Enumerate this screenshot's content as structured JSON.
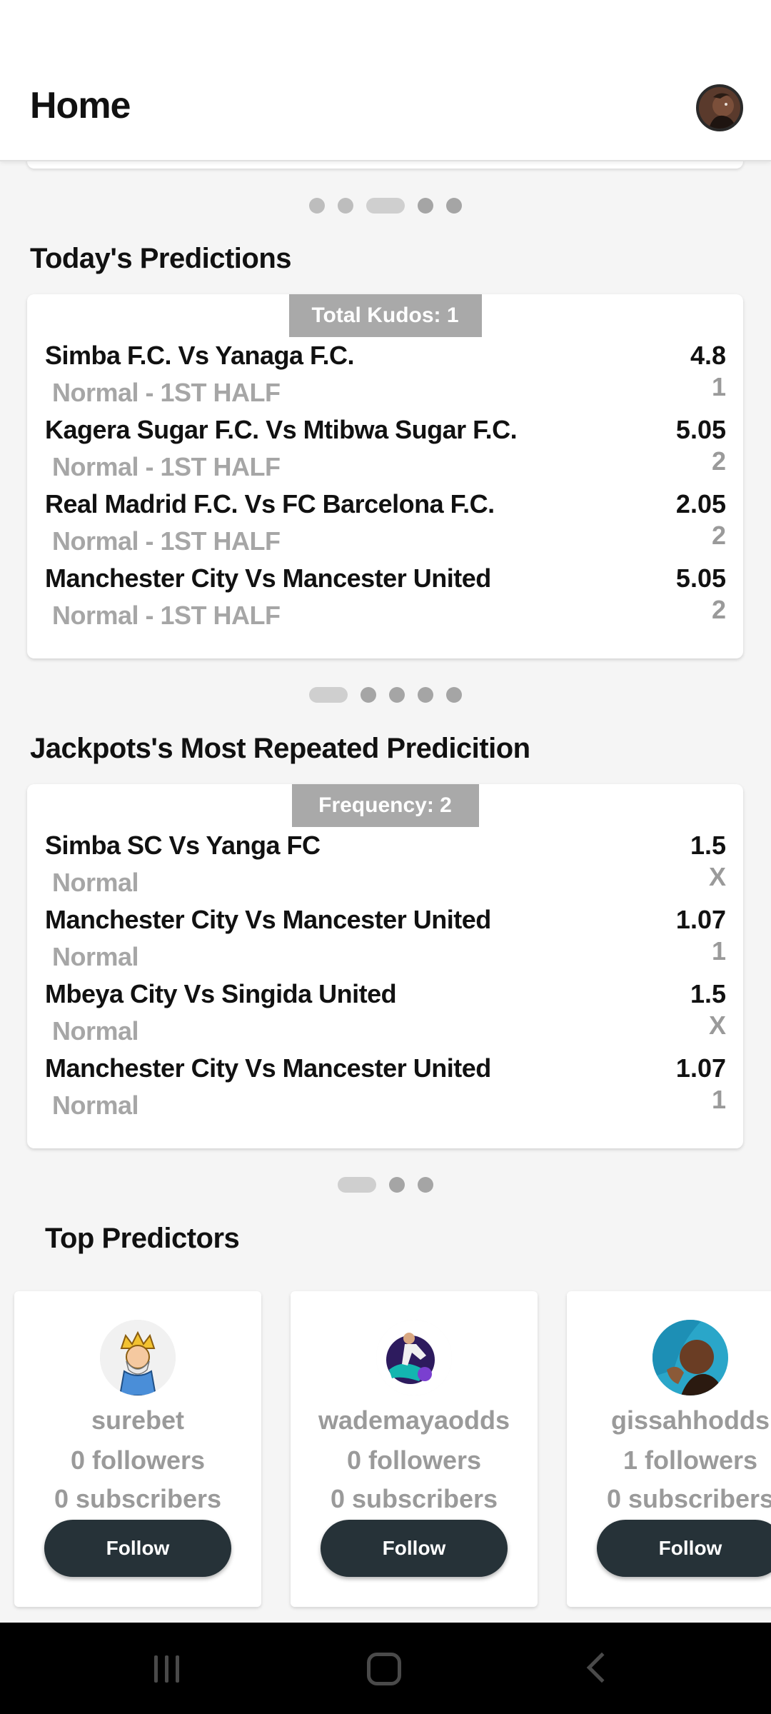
{
  "header": {
    "title": "Home",
    "avatar_icon": "profile-avatar-icon"
  },
  "predictions": {
    "section_title": "Today's Predictions",
    "badge": "Total Kudos: 1",
    "matches": [
      {
        "teams": "Simba F.C. Vs Yanaga F.C.",
        "odds": "4.8",
        "market": "Normal - 1ST HALF",
        "pick": "1"
      },
      {
        "teams": "Kagera Sugar F.C. Vs Mtibwa Sugar F.C.",
        "odds": "5.05",
        "market": "Normal - 1ST HALF",
        "pick": "2"
      },
      {
        "teams": "Real Madrid F.C. Vs FC Barcelona F.C.",
        "odds": "2.05",
        "market": "Normal - 1ST HALF",
        "pick": "2"
      },
      {
        "teams": "Manchester City Vs Mancester United",
        "odds": "5.05",
        "market": "Normal - 1ST HALF",
        "pick": "2"
      }
    ]
  },
  "jackpots": {
    "section_title": "Jackpots's Most Repeated Predicition",
    "badge": "Frequency: 2",
    "matches": [
      {
        "teams": "Simba SC Vs Yanga FC",
        "odds": "1.5",
        "market": "Normal",
        "pick": "X"
      },
      {
        "teams": "Manchester City Vs Mancester United",
        "odds": "1.07",
        "market": "Normal",
        "pick": "1"
      },
      {
        "teams": "Mbeya City Vs Singida United",
        "odds": "1.5",
        "market": "Normal",
        "pick": "X"
      },
      {
        "teams": "Manchester City Vs Mancester United",
        "odds": "1.07",
        "market": "Normal",
        "pick": "1"
      }
    ]
  },
  "top_predictors": {
    "section_title": "Top Predictors",
    "follow_label": "Follow",
    "items": [
      {
        "name": "surebet",
        "followers": "0 followers",
        "subscribers": "0 subscribers"
      },
      {
        "name": "wademayaodds",
        "followers": "0 followers",
        "subscribers": "0 subscribers"
      },
      {
        "name": "gissahhodds",
        "followers": "1 followers",
        "subscribers": "0 subscribers"
      }
    ]
  },
  "carousels": {
    "top_dots_active_index": 2,
    "predictions_dots_active_index": 0,
    "jackpots_dots_active_index": 0
  },
  "navbar": {
    "recents_icon": "recents-icon",
    "home_icon": "home-icon",
    "back_icon": "back-icon"
  }
}
